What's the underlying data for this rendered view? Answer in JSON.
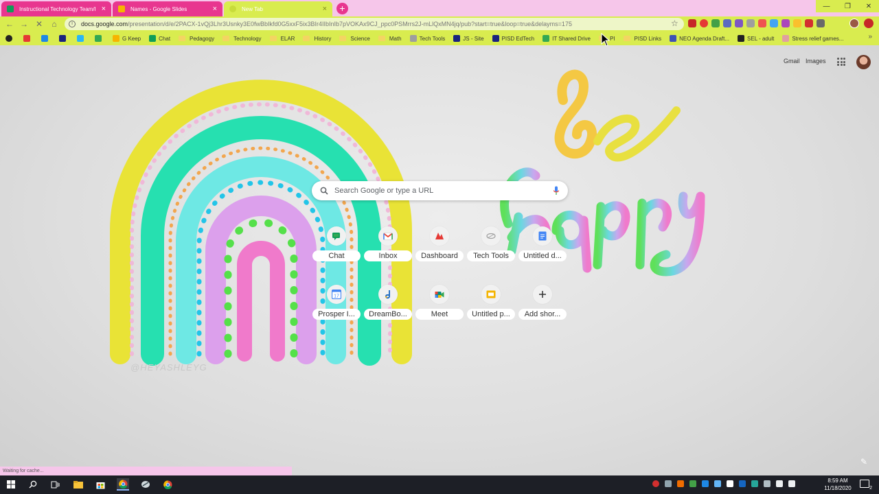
{
  "browser": {
    "tabs": [
      {
        "title": "Instructional Technology Team/I",
        "active": false
      },
      {
        "title": "Names - Google Slides",
        "active": false
      },
      {
        "title": "New Tab",
        "active": true
      }
    ],
    "new_tab_label": "+",
    "omnibox": {
      "host": "docs.google.com",
      "path": "/presentation/d/e/2PACX-1vQj3Lhr3Usnky3E0fwBbIkfd0G5xxF5ix3BIr4IIbInIb7pVOKAx9CJ_ppc0PSMrrs2J-mLlQxMN4jq/pub?start=true&loop=true&delayms=175"
    },
    "bookmarks": [
      {
        "label": "G Keep",
        "type": "link",
        "color": "#f6b400"
      },
      {
        "label": "Chat",
        "type": "link",
        "color": "#0f9d58"
      },
      {
        "label": "Pedagogy",
        "type": "folder"
      },
      {
        "label": "Technology",
        "type": "folder"
      },
      {
        "label": "ELAR",
        "type": "folder"
      },
      {
        "label": "History",
        "type": "folder"
      },
      {
        "label": "Science",
        "type": "folder"
      },
      {
        "label": "Math",
        "type": "folder"
      },
      {
        "label": "Tech Tools",
        "type": "link",
        "color": "#9e9e9e"
      },
      {
        "label": "JS - Site",
        "type": "link",
        "color": "#1a237e"
      },
      {
        "label": "PISD EdTech",
        "type": "link",
        "color": "#1a237e"
      },
      {
        "label": "IT Shared Drive",
        "type": "link",
        "color": "#34a853"
      },
      {
        "label": "PI",
        "type": "folder"
      },
      {
        "label": "PISD Links",
        "type": "folder"
      },
      {
        "label": "NEO Agenda Draft...",
        "type": "link",
        "color": "#3f51b5"
      },
      {
        "label": "SEL - adult",
        "type": "link",
        "color": "#222222"
      },
      {
        "label": "Stress relief games...",
        "type": "link",
        "color": "#e0a0a0"
      }
    ],
    "bookmarks_more": "»"
  },
  "ntp": {
    "header_links": {
      "gmail": "Gmail",
      "images": "Images"
    },
    "search_placeholder": "Search Google or type a URL",
    "shortcuts": [
      {
        "label": "Chat",
        "icon": "chat-icon"
      },
      {
        "label": "Inbox",
        "icon": "gmail-icon"
      },
      {
        "label": "Dashboard",
        "icon": "dashboard-icon"
      },
      {
        "label": "Tech Tools",
        "icon": "tech-tools-icon"
      },
      {
        "label": "Untitled d...",
        "icon": "docs-icon"
      },
      {
        "label": "Prosper I...",
        "icon": "calendar-icon"
      },
      {
        "label": "DreamBo...",
        "icon": "dreambox-icon"
      },
      {
        "label": "Meet",
        "icon": "meet-icon"
      },
      {
        "label": "Untitled p...",
        "icon": "slides-icon"
      },
      {
        "label": "Add shor...",
        "icon": "add-icon"
      }
    ],
    "watermark": "@HEYASHLEYG"
  },
  "status_bubble": "Waiting for cache...",
  "taskbar": {
    "time": "8:59 AM",
    "date": "11/18/2020",
    "notification_count": "2"
  },
  "colors": {
    "tab_pink": "#e8368f",
    "toolbar_lime": "#d9ec4f",
    "tabstrip_pink": "#f6c6ea"
  }
}
